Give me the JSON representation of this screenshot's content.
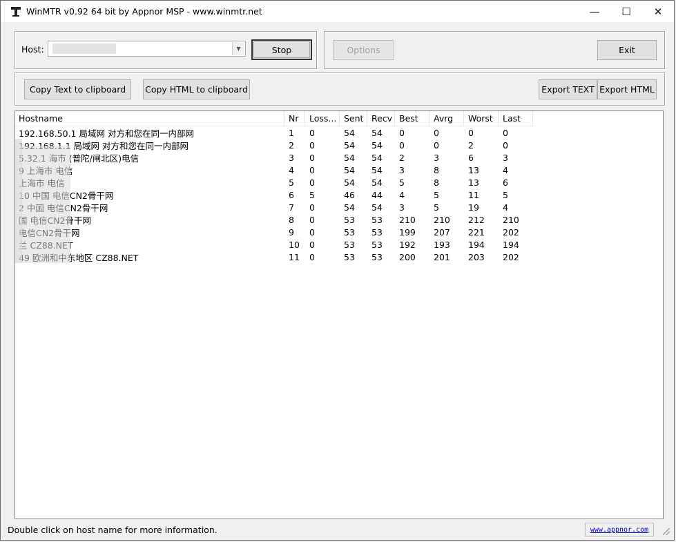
{
  "window": {
    "title": "WinMTR v0.92 64 bit by Appnor MSP - www.winmtr.net",
    "minimize": "—",
    "maximize": "☐",
    "close": "✕"
  },
  "toolbar": {
    "host_label": "Host:",
    "host_value": "",
    "stop_label": "Stop",
    "options_label": "Options",
    "exit_label": "Exit",
    "copy_text_label": "Copy Text to clipboard",
    "copy_html_label": "Copy HTML to clipboard",
    "export_text_label": "Export TEXT",
    "export_html_label": "Export HTML"
  },
  "table": {
    "headers": [
      "Hostname",
      "Nr",
      "Loss...",
      "Sent",
      "Recv",
      "Best",
      "Avrg",
      "Worst",
      "Last"
    ],
    "rows": [
      [
        "192.168.50.1 局域网 对方和您在同一内部网",
        "1",
        "0",
        "54",
        "54",
        "0",
        "0",
        "0",
        "0"
      ],
      [
        "192.168.1.1 局域网 对方和您在同一内部网",
        "2",
        "0",
        "54",
        "54",
        "0",
        "0",
        "2",
        "0"
      ],
      [
        "5.32.1 海市 (普陀/闸北区)电信",
        "3",
        "0",
        "54",
        "54",
        "2",
        "3",
        "6",
        "3"
      ],
      [
        "9 上海市 电信",
        "4",
        "0",
        "54",
        "54",
        "3",
        "8",
        "13",
        "4"
      ],
      [
        "上海市 电信",
        "5",
        "0",
        "54",
        "54",
        "5",
        "8",
        "13",
        "6"
      ],
      [
        "10 中国 电信CN2骨干网",
        "6",
        "5",
        "46",
        "44",
        "4",
        "5",
        "11",
        "5"
      ],
      [
        "2 中国 电信CN2骨干网",
        "7",
        "0",
        "54",
        "54",
        "3",
        "5",
        "19",
        "4"
      ],
      [
        "国 电信CN2骨干网",
        "8",
        "0",
        "53",
        "53",
        "210",
        "210",
        "212",
        "210"
      ],
      [
        "电信CN2骨干网",
        "9",
        "0",
        "53",
        "53",
        "199",
        "207",
        "221",
        "202"
      ],
      [
        "兰 CZ88.NET",
        "10",
        "0",
        "53",
        "53",
        "192",
        "193",
        "194",
        "194"
      ],
      [
        "49 欧洲和中东地区 CZ88.NET",
        "11",
        "0",
        "53",
        "53",
        "200",
        "201",
        "203",
        "202"
      ]
    ]
  },
  "status": {
    "text": "Double click on host name for more information.",
    "link": "www.appnor.com"
  }
}
